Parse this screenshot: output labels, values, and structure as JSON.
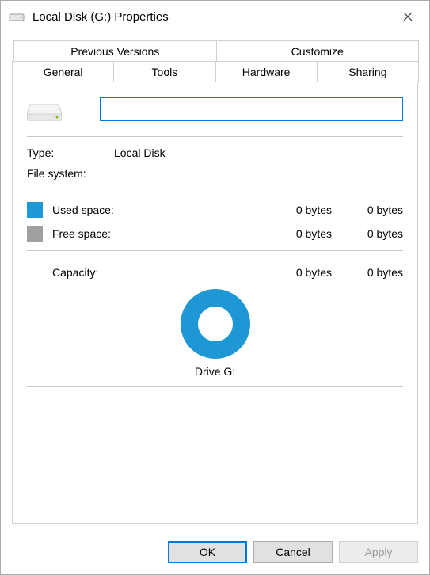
{
  "window": {
    "title": "Local Disk (G:) Properties"
  },
  "tabs": {
    "row1": [
      "Previous Versions",
      "Customize"
    ],
    "row2": [
      "General",
      "Tools",
      "Hardware",
      "Sharing"
    ],
    "active": "General"
  },
  "general": {
    "name_value": "",
    "type_label": "Type:",
    "type_value": "Local Disk",
    "fs_label": "File system:",
    "fs_value": "",
    "used_label": "Used space:",
    "used_bytes": "0 bytes",
    "used_human": "0 bytes",
    "free_label": "Free space:",
    "free_bytes": "0 bytes",
    "free_human": "0 bytes",
    "capacity_label": "Capacity:",
    "capacity_bytes": "0 bytes",
    "capacity_human": "0 bytes",
    "drive_label": "Drive G:"
  },
  "buttons": {
    "ok": "OK",
    "cancel": "Cancel",
    "apply": "Apply"
  },
  "colors": {
    "accent": "#0078d7",
    "used": "#1e98d5",
    "free": "#a0a0a0"
  }
}
